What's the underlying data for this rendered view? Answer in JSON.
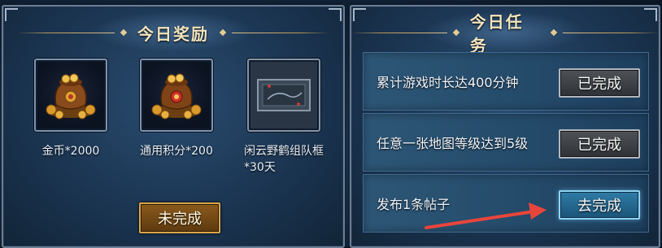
{
  "daily_rewards": {
    "title": "今日奖励",
    "items": [
      {
        "name": "金币*2000",
        "icon": "gold-coin-sack-icon"
      },
      {
        "name": "通用积分*200",
        "icon": "point-coin-sack-icon"
      },
      {
        "name": "闲云野鹤组队框*30天",
        "name_line1": "闲云野鹤组队框",
        "name_line2": "*30天",
        "icon": "team-frame-icon"
      }
    ],
    "status_button": "未完成"
  },
  "daily_tasks": {
    "title": "今日任务",
    "tasks": [
      {
        "label": "累计游戏时长达400分钟",
        "button": "已完成",
        "state": "completed"
      },
      {
        "label": "任意一张地图等级达到5级",
        "button": "已完成",
        "state": "completed"
      },
      {
        "label": "发布1条帖子",
        "button": "去完成",
        "state": "pending"
      }
    ]
  },
  "colors": {
    "accent_gold": "#d9a64a",
    "pending_blue": "#2f7ca7",
    "arrow_red": "#e8453c"
  }
}
